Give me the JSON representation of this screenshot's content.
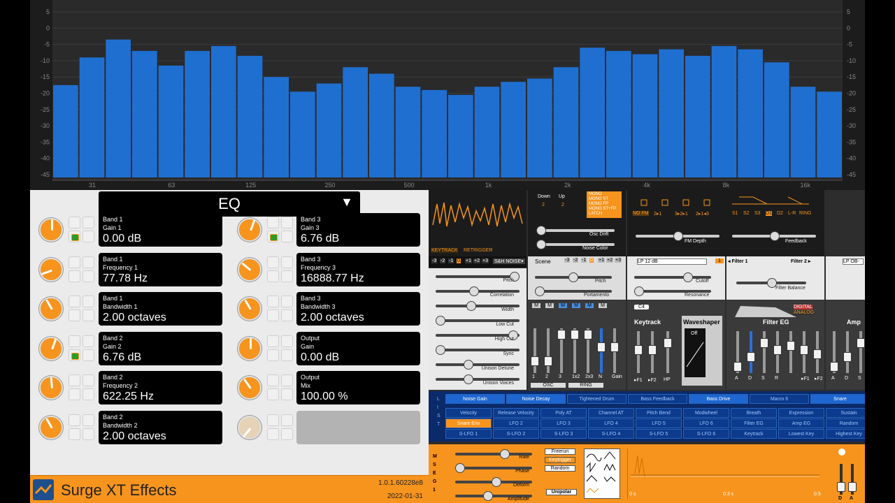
{
  "spectrum": {
    "y_ticks": [
      "5",
      "0",
      "-5",
      "-10",
      "-15",
      "-20",
      "-25",
      "-30",
      "-35",
      "-40",
      "-45"
    ],
    "x_ticks": [
      "31",
      "63",
      "125",
      "250",
      "500",
      "1k",
      "2k",
      "4k",
      "8k",
      "16k"
    ],
    "bars_db": [
      -17.5,
      -9,
      -3.5,
      -7,
      -11.5,
      -7,
      -5.5,
      -8.5,
      -15,
      -19.5,
      -17,
      -12,
      -14,
      -18,
      -19,
      -20.5,
      -18,
      -16.5,
      -15.5,
      -12,
      -6,
      -7,
      -8,
      -6.5,
      -8.5,
      -5.5,
      -6.5,
      -10.5,
      -18,
      -19.5
    ],
    "bar_color": "#1f6fd1",
    "ylim": [
      5,
      -45
    ]
  },
  "effects": {
    "preset": "EQ",
    "preset_arrow": "▼",
    "left": [
      {
        "l1": "Band 1",
        "l2": "Gain 1",
        "v": "0.00 dB",
        "angle": 180,
        "link": true
      },
      {
        "l1": "Band 1",
        "l2": "Frequency 1",
        "v": "77.78 Hz",
        "angle": 70,
        "link": false
      },
      {
        "l1": "Band 1",
        "l2": "Bandwidth 1",
        "v": "2.00 octaves",
        "angle": 150,
        "link": false
      },
      {
        "l1": "Band 2",
        "l2": "Gain 2",
        "v": "6.76 dB",
        "angle": 200,
        "link": true
      },
      {
        "l1": "Band 2",
        "l2": "Frequency 2",
        "v": "622.25 Hz",
        "angle": 175,
        "link": false
      },
      {
        "l1": "Band 2",
        "l2": "Bandwidth 2",
        "v": "2.00 octaves",
        "angle": 150,
        "link": false
      }
    ],
    "right": [
      {
        "l1": "Band 3",
        "l2": "Gain 3",
        "v": "6.76 dB",
        "angle": 200,
        "link": true
      },
      {
        "l1": "Band 3",
        "l2": "Frequency 3",
        "v": "16888.77 Hz",
        "angle": 130,
        "link": false
      },
      {
        "l1": "Band 3",
        "l2": "Bandwidth 3",
        "v": "2.00 octaves",
        "angle": 150,
        "link": false
      },
      {
        "l1": "Output",
        "l2": "Gain",
        "v": "0.00 dB",
        "angle": 180,
        "link": false
      },
      {
        "l1": "Output",
        "l2": "Mix",
        "v": "100.00 %",
        "angle": 145,
        "link": false
      },
      {
        "l1": "",
        "l2": "",
        "v": "",
        "angle": 40,
        "link": false
      }
    ],
    "footer": {
      "name": "Surge XT Effects",
      "version": "1.0.1.60228e8",
      "date": "2022-01-31"
    }
  },
  "synth": {
    "keytrack": "KEYTRACK",
    "retrigger": "RETRIGGER",
    "snh": "S&H NOISE▾",
    "oct_nums": [
      "-3",
      "-2",
      "-1",
      "0",
      "+1",
      "+2",
      "+3"
    ],
    "down": "Down",
    "up": "Up",
    "two": "2",
    "osc_modes": [
      "MONO",
      "MONO ST",
      "MONO FP",
      "MONO ST+FP",
      "LATCH"
    ],
    "osc_drift": "Osc Drift",
    "noise_color": "Noise Color",
    "fm_depth": "FM Depth",
    "feedback": "Feedback",
    "fm_routes": [
      "NO FM",
      "2▸1",
      "3▸2▸1",
      "2▸1◂3"
    ],
    "filt_routes": [
      "S1",
      "S2",
      "S3",
      "D1",
      "D2",
      "L-R",
      "RING"
    ],
    "scene": "Scene",
    "pitch": "Pitch",
    "portamento": "Portamento",
    "cutoff": "Cutoff",
    "resonance": "Resonance",
    "filter_balance": "Filter Balance",
    "filter_type": "LP 12 dB",
    "filter1": "◂ Filter 1",
    "filter2": "Filter 2 ▸",
    "one": "1",
    "filter_type2": "LP OB-",
    "osc_params": [
      "Pitch",
      "Correlation",
      "Width",
      "Low Cut",
      "High Cut",
      "Sync",
      "Unison Detune",
      "Unison Voices"
    ],
    "mixer_ms": [
      "M",
      "M",
      "M",
      "M",
      "M",
      "M"
    ],
    "mixer_labels": [
      "1",
      "2",
      "3",
      "1x2",
      "2x3",
      "N",
      "Gain"
    ],
    "osc": "OSC",
    "ring": "RING",
    "c4": "C4",
    "keytrack_t": "Keytrack",
    "waveshaper": "Waveshaper",
    "ws_off": "Off",
    "f1": "▸F1",
    "f2": "▸F2",
    "hp": "HP",
    "filter_eg": "Filter EG",
    "digital": "DIGITAL",
    "analog": "ANALOG",
    "amp": "Amp",
    "adsr": [
      "A",
      "D",
      "S",
      "R"
    ],
    "lfo_side": "L I S T",
    "mod_row1": [
      "Noise Gain",
      "Noise Decay",
      "Tightened Drum",
      "Bass Feedback",
      "Bass Drive",
      "Macro 6",
      "Snare"
    ],
    "mod_row2": [
      "Velocity",
      "Release Velocity",
      "Poly AT",
      "Channel AT",
      "Pitch Bend",
      "Modwheel",
      "Breath",
      "Expression",
      "Sustain"
    ],
    "mod_row3": [
      "Snare Env",
      "LFO 2",
      "LFO 3",
      "LFO 4",
      "LFO 5",
      "LFO 6",
      "Filter EG",
      "Amp EG",
      "Random"
    ],
    "mod_row4": [
      "S-LFO 1",
      "S-LFO 2",
      "S-LFO 3",
      "S-LFO 4",
      "S-LFO 5",
      "S-LFO 6",
      "Keytrack",
      "Lowest Key",
      "Highest Key"
    ],
    "mseg_side": [
      "M",
      "S",
      "E",
      "G",
      "1"
    ],
    "lfo_params": [
      "Rate",
      "Phase",
      "Deform",
      "Amplitude"
    ],
    "trig": [
      "Freerun",
      "Keytrigger",
      "Random"
    ],
    "unipolar": "Unipolar",
    "time": [
      "0 s",
      "0.3 s",
      "0.5"
    ],
    "da": [
      "D",
      "A"
    ]
  }
}
